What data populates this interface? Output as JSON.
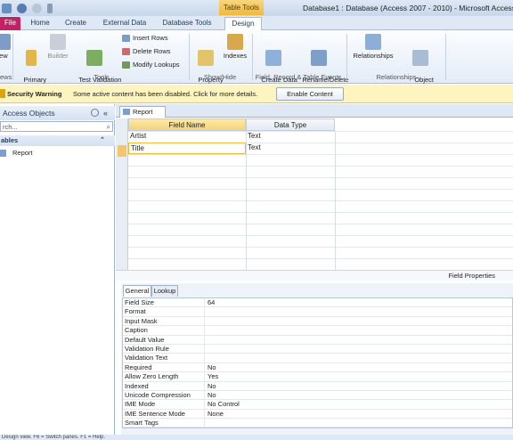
{
  "window": {
    "contextual_tab": "Table Tools",
    "title": "Database1 : Database (Access 2007 - 2010)  -  Microsoft Access"
  },
  "tabs": [
    "File",
    "Home",
    "Create",
    "External Data",
    "Database Tools",
    "Design"
  ],
  "ribbon": {
    "views_label": "iew",
    "views_group": "ews",
    "primary_key": "Primary\nKey",
    "builder": "Builder",
    "test_validation": "Test Validation\nRules",
    "insert_rows": "Insert Rows",
    "delete_rows": "Delete Rows",
    "modify_lookups": "Modify Lookups",
    "tools_group": "Tools",
    "property_sheet": "Property\nSheet",
    "indexes": "Indexes",
    "showhide_group": "Show/Hide",
    "create_data_macros": "Create Data\nMacros",
    "rename_delete_macro": "Rename/Delete\nMacro",
    "field_events_group": "Field, Record & Table Events",
    "relationships": "Relationships",
    "object_dependencies": "Object\nDependencies",
    "relationships_group": "Relationships"
  },
  "security": {
    "title": "Security Warning",
    "message": "Some active content has been disabled. Click for more details.",
    "button": "Enable Content"
  },
  "nav": {
    "header": "Access Objects",
    "search": "rch...",
    "group": "ables",
    "items": [
      "Report"
    ]
  },
  "document": {
    "tab": "Report"
  },
  "grid": {
    "headers": [
      "Field Name",
      "Data Type"
    ],
    "rows": [
      [
        "Artist",
        "Text"
      ],
      [
        "Title",
        "Text"
      ]
    ]
  },
  "field_properties_label": "Field Properties",
  "props_tabs": [
    "General",
    "Lookup"
  ],
  "properties": [
    [
      "Field Size",
      "64"
    ],
    [
      "Format",
      ""
    ],
    [
      "Input Mask",
      ""
    ],
    [
      "Caption",
      ""
    ],
    [
      "Default Value",
      ""
    ],
    [
      "Validation Rule",
      ""
    ],
    [
      "Validation Text",
      ""
    ],
    [
      "Required",
      "No"
    ],
    [
      "Allow Zero Length",
      "Yes"
    ],
    [
      "Indexed",
      "No"
    ],
    [
      "Unicode Compression",
      "No"
    ],
    [
      "IME Mode",
      "No Control"
    ],
    [
      "IME Sentence Mode",
      "None"
    ],
    [
      "Smart Tags",
      ""
    ]
  ],
  "statusbar": "Design view.  F6 = Switch panes.  F1 = Help."
}
